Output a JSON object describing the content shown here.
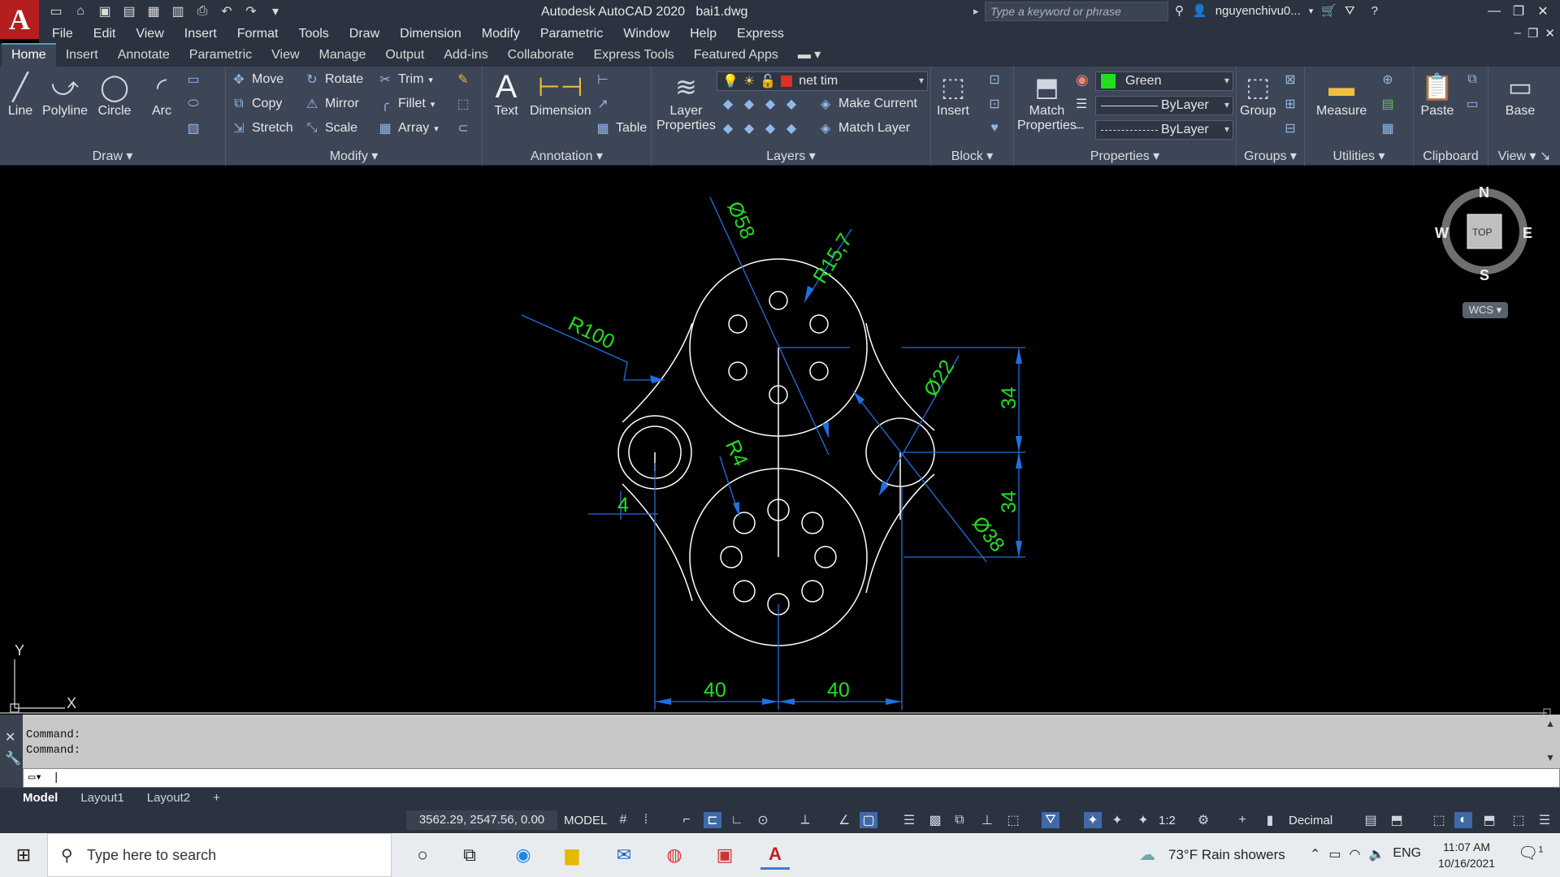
{
  "window": {
    "title": "Autodesk AutoCAD 2020",
    "file": "bai1.dwg",
    "search_placeholder": "Type a keyword or phrase",
    "user": "nguyenchivu0..."
  },
  "menu": [
    "File",
    "Edit",
    "View",
    "Insert",
    "Format",
    "Tools",
    "Draw",
    "Dimension",
    "Modify",
    "Parametric",
    "Window",
    "Help",
    "Express"
  ],
  "ribbon_tabs": [
    "Home",
    "Insert",
    "Annotate",
    "Parametric",
    "View",
    "Manage",
    "Output",
    "Add-ins",
    "Collaborate",
    "Express Tools",
    "Featured Apps"
  ],
  "ribbon": {
    "draw": {
      "title": "Draw",
      "line": "Line",
      "polyline": "Polyline",
      "circle": "Circle",
      "arc": "Arc"
    },
    "modify": {
      "title": "Modify",
      "move": "Move",
      "rotate": "Rotate",
      "trim": "Trim",
      "copy": "Copy",
      "mirror": "Mirror",
      "fillet": "Fillet",
      "stretch": "Stretch",
      "scale": "Scale",
      "array": "Array"
    },
    "annotation": {
      "title": "Annotation",
      "text": "Text",
      "dimension": "Dimension",
      "table": "Table"
    },
    "layers": {
      "title": "Layers",
      "layer_properties_1": "Layer",
      "layer_properties_2": "Properties",
      "current_layer": "net tim",
      "make_current": "Make Current",
      "match_layer": "Match Layer"
    },
    "block": {
      "title": "Block",
      "insert": "Insert"
    },
    "properties": {
      "title": "Properties",
      "match_1": "Match",
      "match_2": "Properties",
      "color": "Green",
      "linetype": "ByLayer",
      "lineweight": "ByLayer"
    },
    "groups": {
      "title": "Groups",
      "group": "Group"
    },
    "utilities": {
      "title": "Utilities",
      "measure": "Measure"
    },
    "clipboard": {
      "title": "Clipboard",
      "paste": "Paste"
    },
    "view": {
      "title": "View",
      "base": "Base"
    }
  },
  "drawing": {
    "dimensions": {
      "d58": "Ø58",
      "r157": "R15,7",
      "r100": "R100",
      "d22": "Ø22",
      "r4": "R4",
      "four": "4",
      "d38": "Ø38",
      "v34a": "34",
      "v34b": "34",
      "h40a": "40",
      "h40b": "40"
    },
    "viewcube": {
      "n": "N",
      "s": "S",
      "e": "E",
      "w": "W",
      "face": "TOP"
    },
    "wcs": "WCS",
    "ucs_x": "X",
    "ucs_y": "Y"
  },
  "command": {
    "history": [
      "Command:",
      "Command:"
    ]
  },
  "layout_tabs": [
    "Model",
    "Layout1",
    "Layout2",
    "+"
  ],
  "status": {
    "coords": "3562.29, 2547.56, 0.00",
    "mode": "MODEL",
    "scale": "1:2",
    "units": "Decimal"
  },
  "taskbar": {
    "search_placeholder": "Type here to search",
    "weather": "73°F  Rain showers",
    "lang": "ENG",
    "time": "11:07 AM",
    "date": "10/16/2021",
    "notifications": "1"
  },
  "colors": {
    "dimension_text": "#1ee01e",
    "dimension_line": "#1f6fe0",
    "geometry": "#ffffff"
  }
}
